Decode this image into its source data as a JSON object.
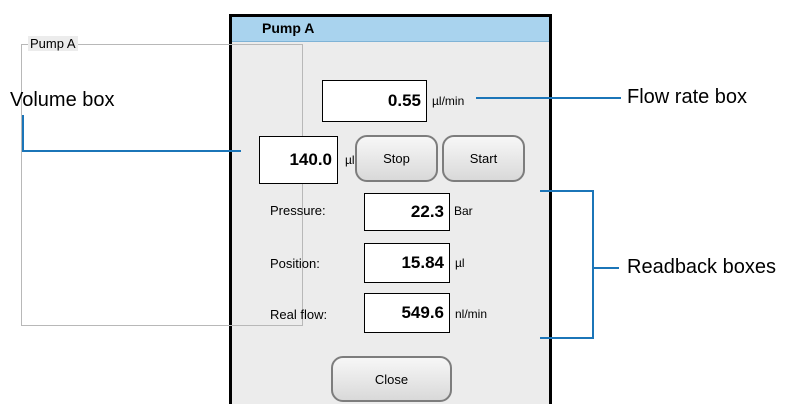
{
  "window": {
    "title": "Pump A",
    "group_label": "Pump A"
  },
  "flow_rate": {
    "value": "0.55",
    "unit": "µl/min"
  },
  "volume": {
    "value": "140.0",
    "unit": "µl"
  },
  "buttons": {
    "stop": "Stop",
    "start": "Start",
    "close": "Close"
  },
  "readbacks": [
    {
      "label": "Pressure:",
      "value": "22.3",
      "unit": "Bar"
    },
    {
      "label": "Position:",
      "value": "15.84",
      "unit": "µl"
    },
    {
      "label": "Real flow:",
      "value": "549.6",
      "unit": "nl/min"
    }
  ],
  "annotations": {
    "volume_box": "Volume box",
    "flow_rate_box": "Flow rate box",
    "readback_boxes": "Readback boxes"
  },
  "colors": {
    "titlebar": "#a9d3ee",
    "callout_line": "#1b75b8"
  }
}
